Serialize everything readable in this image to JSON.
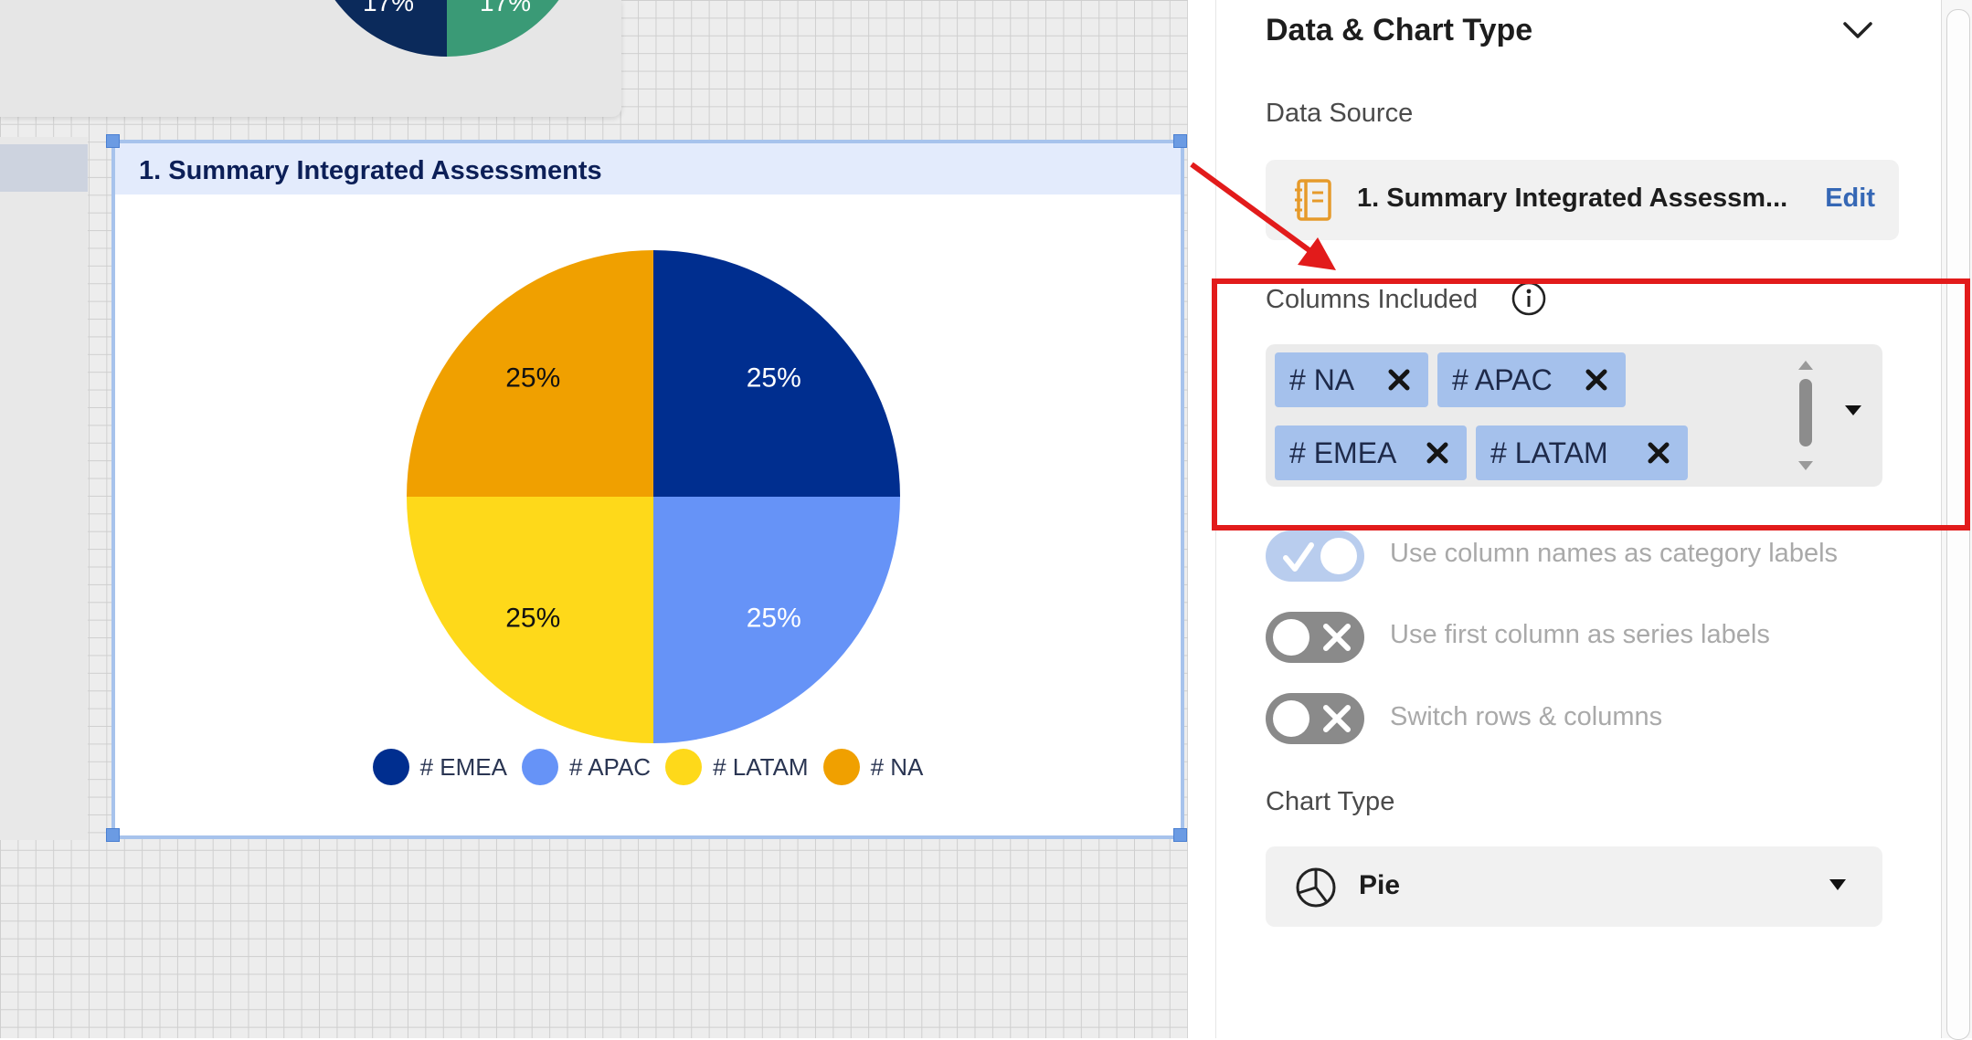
{
  "top_chart": {
    "labels": [
      "17%",
      "17%"
    ],
    "colors": [
      "#0b2a5b",
      "#3a9a76"
    ]
  },
  "chart_card": {
    "title": "1. Summary Integrated Assessments"
  },
  "chart_data": {
    "type": "pie",
    "title": "1. Summary Integrated Assessments",
    "slices": [
      {
        "name": "# EMEA",
        "value": 25,
        "label": "25%",
        "color": "#002e8f"
      },
      {
        "name": "# APAC",
        "value": 25,
        "label": "25%",
        "color": "#6693f7"
      },
      {
        "name": "# LATAM",
        "value": 25,
        "label": "25%",
        "color": "#fed91a"
      },
      {
        "name": "# NA",
        "value": 25,
        "label": "25%",
        "color": "#f0a000"
      }
    ],
    "legend_position": "bottom"
  },
  "panel": {
    "title": "Data & Chart Type",
    "data_source_label": "Data Source",
    "data_source_value": "1. Summary Integrated Assessm...",
    "edit_label": "Edit",
    "columns_label": "Columns Included",
    "columns": [
      "# NA",
      "# APAC",
      "# EMEA",
      "# LATAM"
    ],
    "toggles": [
      {
        "label": "Use column names as category labels",
        "on": true
      },
      {
        "label": "Use first column as series labels",
        "on": false
      },
      {
        "label": "Switch rows & columns",
        "on": false
      }
    ],
    "chart_type_label": "Chart Type",
    "chart_type_value": "Pie"
  },
  "colors": {
    "highlight": "#e21b1b",
    "chip": "#a5c1ec",
    "link": "#3567b5"
  }
}
